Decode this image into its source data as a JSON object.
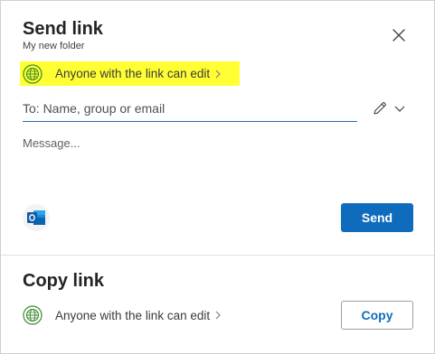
{
  "colors": {
    "accent": "#0f6cbd",
    "highlight": "#ffff33",
    "globe": "#3a8a2e",
    "input_underline": "#2b6cb0"
  },
  "send_link": {
    "title": "Send link",
    "subtitle": "My new folder",
    "permission_label": "Anyone with the link can edit",
    "to_placeholder": "To: Name, group or email",
    "message_placeholder": "Message...",
    "send_label": "Send",
    "icons": {
      "close": "close-icon",
      "globe": "globe-icon",
      "chevron": "chevron-right-icon",
      "edit": "pencil-icon",
      "dropdown": "chevron-down-icon",
      "outlook": "outlook-icon"
    }
  },
  "copy_link": {
    "title": "Copy link",
    "permission_label": "Anyone with the link can edit",
    "copy_label": "Copy"
  }
}
